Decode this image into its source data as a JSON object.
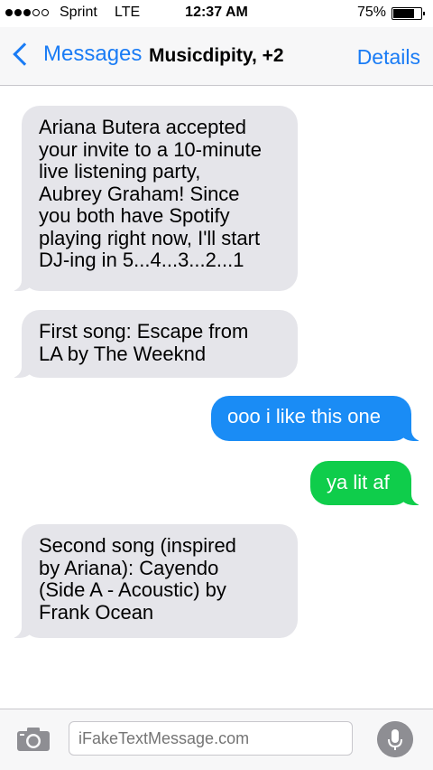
{
  "status_bar": {
    "signal_full": 3,
    "signal_total": 5,
    "carrier": "Sprint",
    "network": "LTE",
    "time": "12:37 AM",
    "battery_percent": "75%",
    "battery_level": 0.75
  },
  "nav": {
    "back_label": "Messages",
    "title": "Musicdipity, +2",
    "details_label": "Details",
    "accent_color": "#1a7cf5"
  },
  "messages": [
    {
      "direction": "incoming",
      "text": "Ariana Butera accepted\nyour invite to a 10-minute\nlive listening party,\nAubrey Graham! Since\nyou both have Spotify\nplaying right now, I'll start\nDJ-ing in 5...4...3...2...1"
    },
    {
      "direction": "incoming",
      "text": "First song: Escape from\nLA by The Weeknd"
    },
    {
      "direction": "outgoing",
      "service": "iMessage",
      "color": "#1a8cf5",
      "text": "ooo i like this one"
    },
    {
      "direction": "outgoing",
      "service": "SMS",
      "color": "#0fcd4b",
      "text": "ya lit af"
    },
    {
      "direction": "incoming",
      "text": "Second song (inspired\nby Ariana): Cayendo\n(Side A - Acoustic) by\nFrank Ocean"
    }
  ],
  "input_bar": {
    "camera_icon": "camera-icon",
    "placeholder": "iFakeTextMessage.com",
    "mic_icon": "microphone-icon"
  }
}
